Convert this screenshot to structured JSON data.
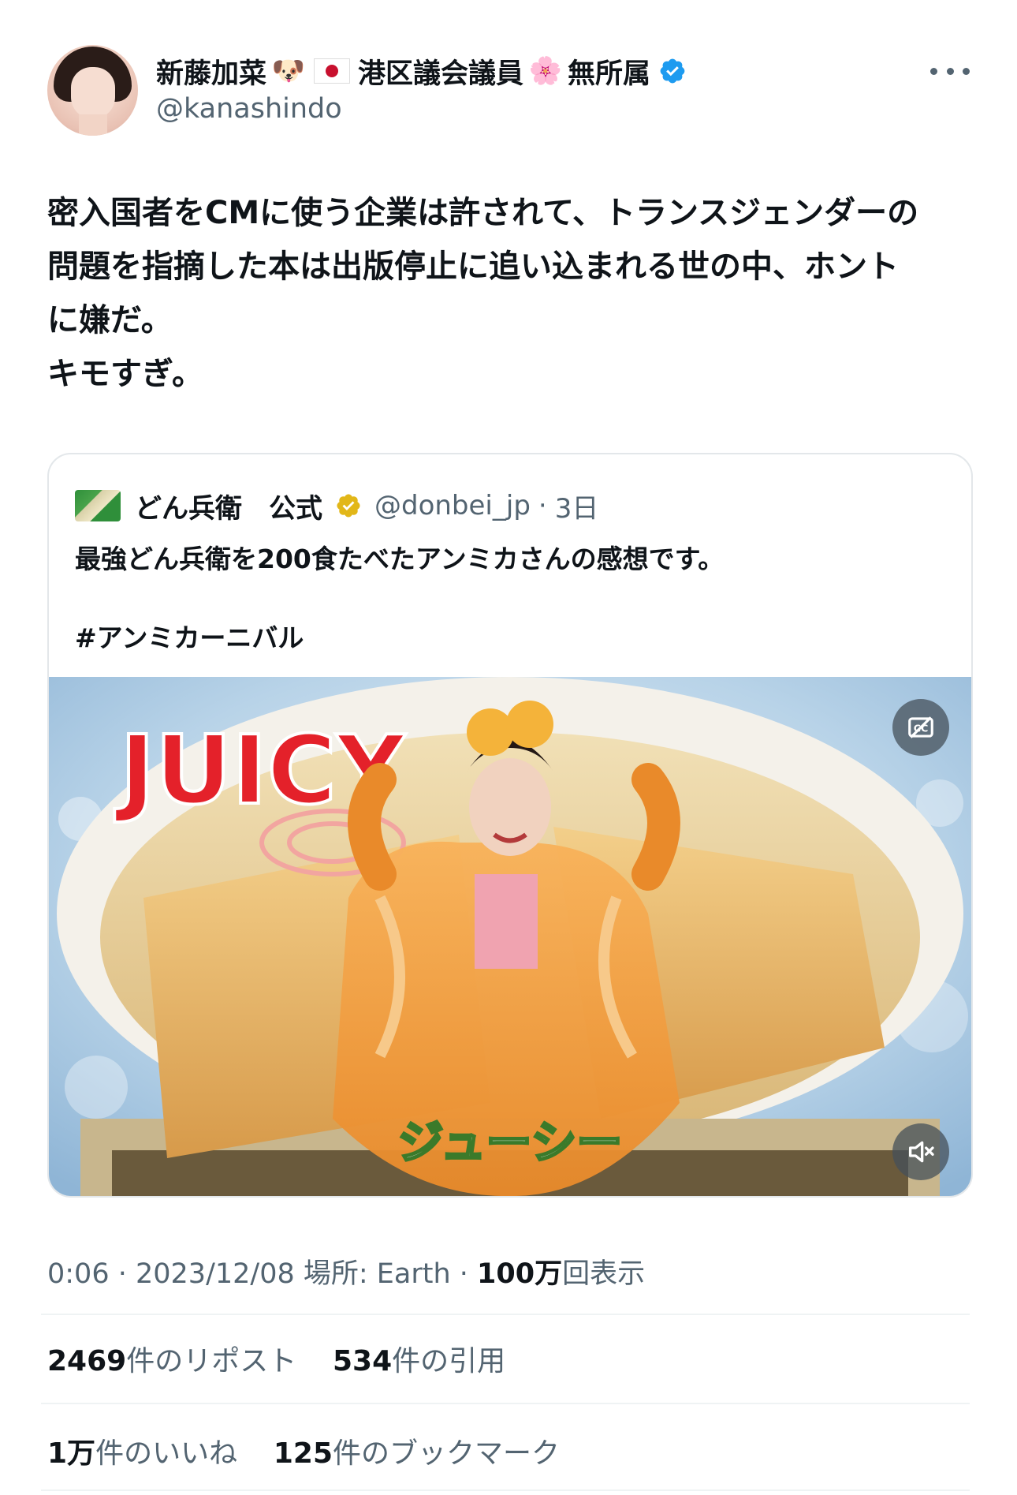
{
  "author": {
    "display_name_part1": "新藤加菜",
    "dog_emoji": "🐶",
    "display_name_part2": "港区議会議員",
    "flower_emoji": "🌸",
    "display_name_part3": "無所属",
    "handle": "@kanashindo",
    "verified_color": "#1d9bf0"
  },
  "tweet": {
    "lines": [
      "密入国者をCMに使う企業は許されて、トランスジェンダーの",
      "問題を指摘した本は出版停止に追い込まれる世の中、ホント",
      "に嫌だ。",
      "キモすぎ。"
    ]
  },
  "quote": {
    "name": "どん兵衛　公式",
    "handle": "@donbei_jp",
    "separator": "·",
    "time": "3日",
    "text": "最強どん兵衛を200食たべたアンミカさんの感想です。",
    "hashtag": "#アンミカーニバル",
    "verified_color": "#e2b719",
    "media": {
      "title_text": "JUICY",
      "caption": "ジューシー"
    }
  },
  "meta": {
    "time": "0:06",
    "sep1": " · ",
    "date": "2023/12/08",
    "location": "場所: Earth",
    "sep2": " · ",
    "views_count": "100万",
    "views_label": "回表示"
  },
  "stats": {
    "reposts_count": "2469",
    "reposts_label": "件のリポスト",
    "quotes_count": "534",
    "quotes_label": "件の引用",
    "likes_count": "1万",
    "likes_label": "件のいいね",
    "bookmarks_count": "125",
    "bookmarks_label": "件のブックマーク"
  }
}
